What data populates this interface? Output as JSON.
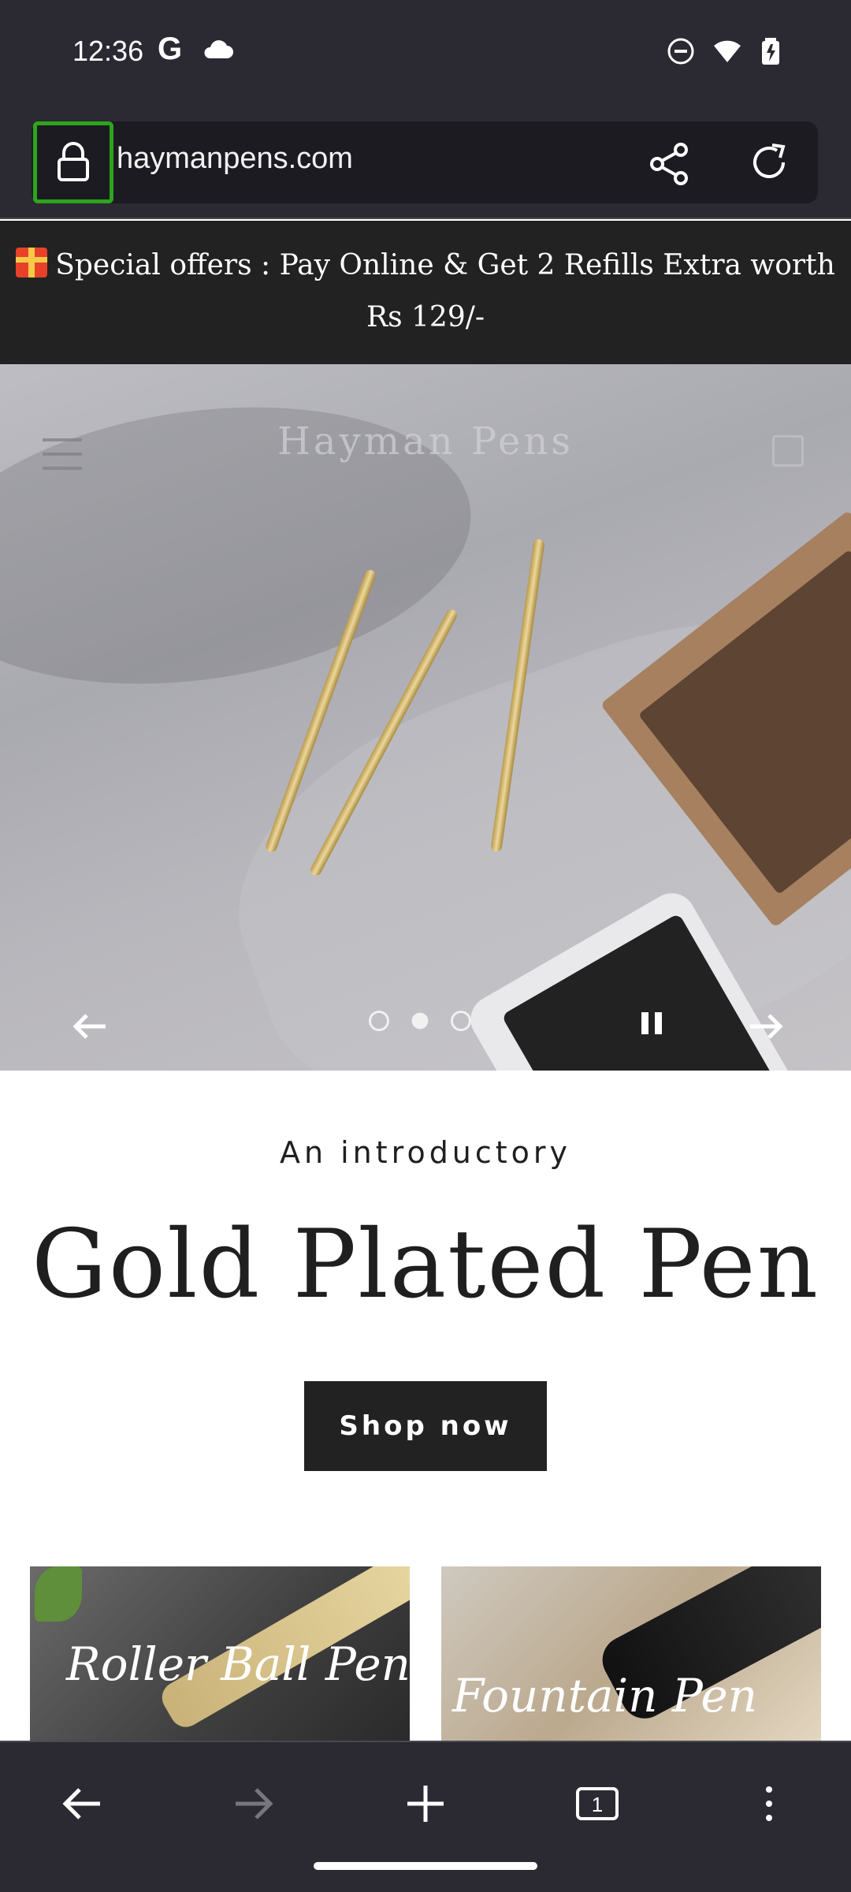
{
  "status_bar": {
    "time": "12:36",
    "g_label": "G"
  },
  "browser": {
    "url": "haymanpens.com",
    "tab_count": "1"
  },
  "announcement": {
    "text": "Special offers : Pay Online & Get 2 Refills Extra worth Rs 129/-"
  },
  "hero": {
    "logo_text": "Hayman Pens",
    "slide_count": 3,
    "active_slide": 2
  },
  "intro": {
    "subtitle": "An introductory",
    "title": "Gold Plated Pen",
    "button": "Shop now"
  },
  "categories": [
    {
      "label": "Roller Ball Pen"
    },
    {
      "label": "Fountain Pen"
    }
  ],
  "colors": {
    "browser_chrome": "#2b2a33",
    "highlight": "#2da51c",
    "announcement_bg": "#222222",
    "button_bg": "#222222"
  }
}
